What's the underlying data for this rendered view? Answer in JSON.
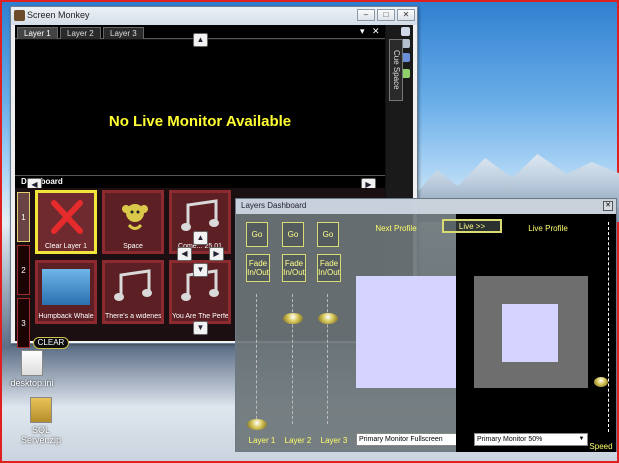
{
  "colors": {
    "accent_yellow": "#ffff33",
    "cue_red": "#8d2a30",
    "cue_selected": "#f2e63a",
    "preview_lavender": "#d5d3ff",
    "desktop_frame": "#e02020"
  },
  "desktop": {
    "icons": [
      {
        "label": "desktop.ini",
        "icon": "file-icon"
      },
      {
        "label": "SQL Server.zip",
        "icon": "zip-folder-icon"
      }
    ]
  },
  "main_window": {
    "title": "Screen Monkey",
    "controls": {
      "minimize": "–",
      "maximize": "□",
      "close": "✕"
    },
    "tabs": [
      {
        "label": "Layer 1",
        "active": true
      },
      {
        "label": "Layer 2",
        "active": false
      },
      {
        "label": "Layer 3",
        "active": false
      }
    ],
    "tab_controls": {
      "dropdown": "▾",
      "close": "✕"
    },
    "monitor_message": "No Live Monitor Available",
    "side_tab": "Cue Space",
    "dashboard_label": "Dashboard",
    "layer_numbers": [
      "1",
      "2",
      "3"
    ],
    "cues": [
      {
        "label": "Clear Layer 1",
        "icon": "clear-x-icon",
        "selected": true
      },
      {
        "label": "Space",
        "icon": "monkey-icon",
        "selected": false
      },
      {
        "label": "Come... 25.01",
        "icon": "music-notes-icon",
        "selected": false
      },
      {
        "label": "Humpback Whale",
        "icon": "whale-image-icon",
        "selected": false
      },
      {
        "label": "There's a wideness",
        "icon": "music-notes-icon",
        "selected": false
      },
      {
        "label": "You Are The Perfect",
        "icon": "music-notes-icon",
        "selected": false
      }
    ],
    "clear_button": "CLEAR"
  },
  "layers_dashboard": {
    "title": "Layers Dashboard",
    "close": "✕",
    "go_labels": [
      "Go",
      "Go",
      "Go"
    ],
    "fade_labels": [
      "Fade In/Out",
      "Fade In/Out",
      "Fade In/Out"
    ],
    "layer_labels": [
      "Layer 1",
      "Layer 2",
      "Layer 3"
    ],
    "next_profile": "Next Profile",
    "live_button": "Live >>",
    "live_profile": "Live Profile",
    "next_monitor_select": "Primary Monitor Fullscreen",
    "live_monitor_select": "Primary Monitor 50%",
    "speed_label": "Speed",
    "fader_levels": [
      0.0,
      0.85,
      0.85
    ]
  }
}
